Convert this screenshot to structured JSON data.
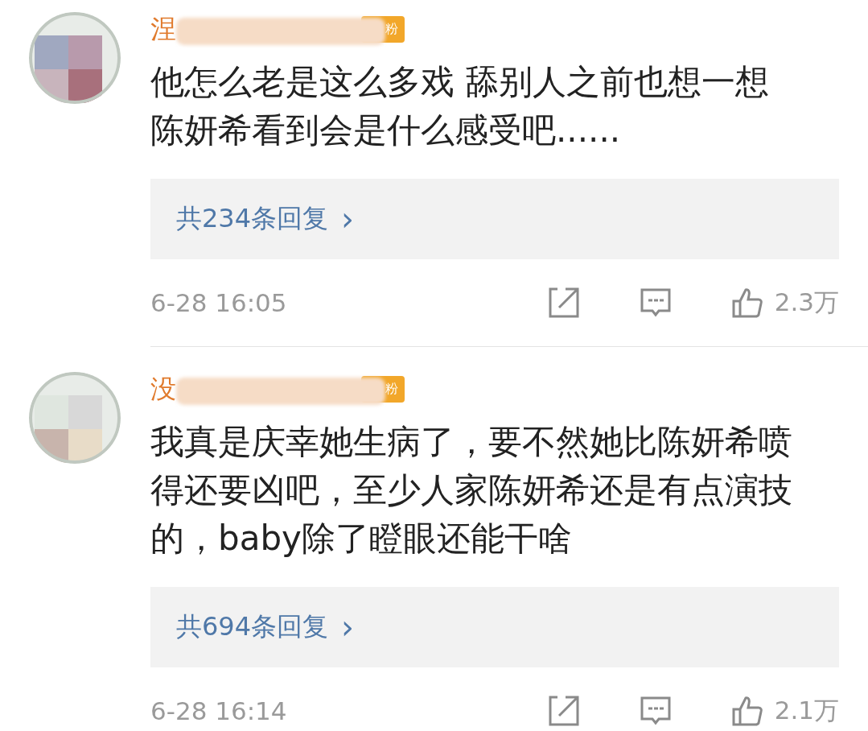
{
  "comments": [
    {
      "name_visible": "涅",
      "badge": "粉",
      "lines": [
        "他怎么老是这么多戏 舔别人之前也想一想",
        "陈妍希看到会是什么感受吧......"
      ],
      "replies": "共234条回复",
      "reply_arrow": "›",
      "time": "6-28 16:05",
      "likes": "2.3万",
      "avatar": {
        "kind": "picture"
      }
    },
    {
      "name_visible": "没",
      "badge": "粉",
      "lines": [
        "我真是庆幸她生病了，要不然她比陈妍希喷",
        "得还要凶吧，至少人家陈妍希还是有点演技",
        "的，baby除了瞪眼还能干啥"
      ],
      "replies": "共694条回复",
      "reply_arrow": "›",
      "time": "6-28 16:14",
      "likes": "2.1万",
      "avatar": {
        "kind": "picture"
      }
    }
  ]
}
